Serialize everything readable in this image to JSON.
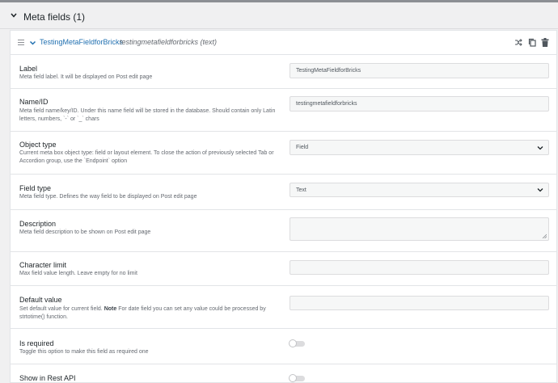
{
  "section": {
    "title": "Meta fields (1)"
  },
  "field": {
    "name": "TestingMetaFieldforBricks",
    "meta": "testingmetafieldforbricks (text)",
    "header_icons": [
      "shuffle-icon",
      "copy-icon",
      "trash-icon"
    ]
  },
  "rows": {
    "label": {
      "title": "Label",
      "desc": "Meta field label. It will be displayed on Post edit page",
      "value": "TestingMetaFieldforBricks"
    },
    "name_id": {
      "title": "Name/ID",
      "desc": "Meta field name/key/ID. Under this name field will be stored in the database. Should contain only Latin letters, numbers, `-` or `_` chars",
      "value": "testingmetafieldforbricks"
    },
    "object_type": {
      "title": "Object type",
      "desc": "Current meta box object type: field or layout element. To close the action of previously selected Tab or Accordion group, use the `Endpoint` option",
      "value": "Field"
    },
    "field_type": {
      "title": "Field type",
      "desc": "Meta field type. Defines the way field to be displayed on Post edit page",
      "value": "Text"
    },
    "description": {
      "title": "Description",
      "desc": "Meta field description to be shown on Post edit page",
      "value": ""
    },
    "char_limit": {
      "title": "Character limit",
      "desc": "Max field value length. Leave empty for no limit",
      "value": ""
    },
    "default_value": {
      "title": "Default value",
      "desc_pre": "Set default value for current field.",
      "desc_note": "Note",
      "desc_post": "For date field you can set any value could be processed by strtotime() function.",
      "value": ""
    },
    "is_required": {
      "title": "Is required",
      "desc": "Toggle this option to make this field as required one",
      "on": false
    },
    "show_in_rest": {
      "title": "Show in Rest API",
      "on": false
    }
  },
  "colors": {
    "accent": "#2271b1",
    "text": "#1d2327",
    "muted": "#646970",
    "border": "#e2e4e7"
  }
}
